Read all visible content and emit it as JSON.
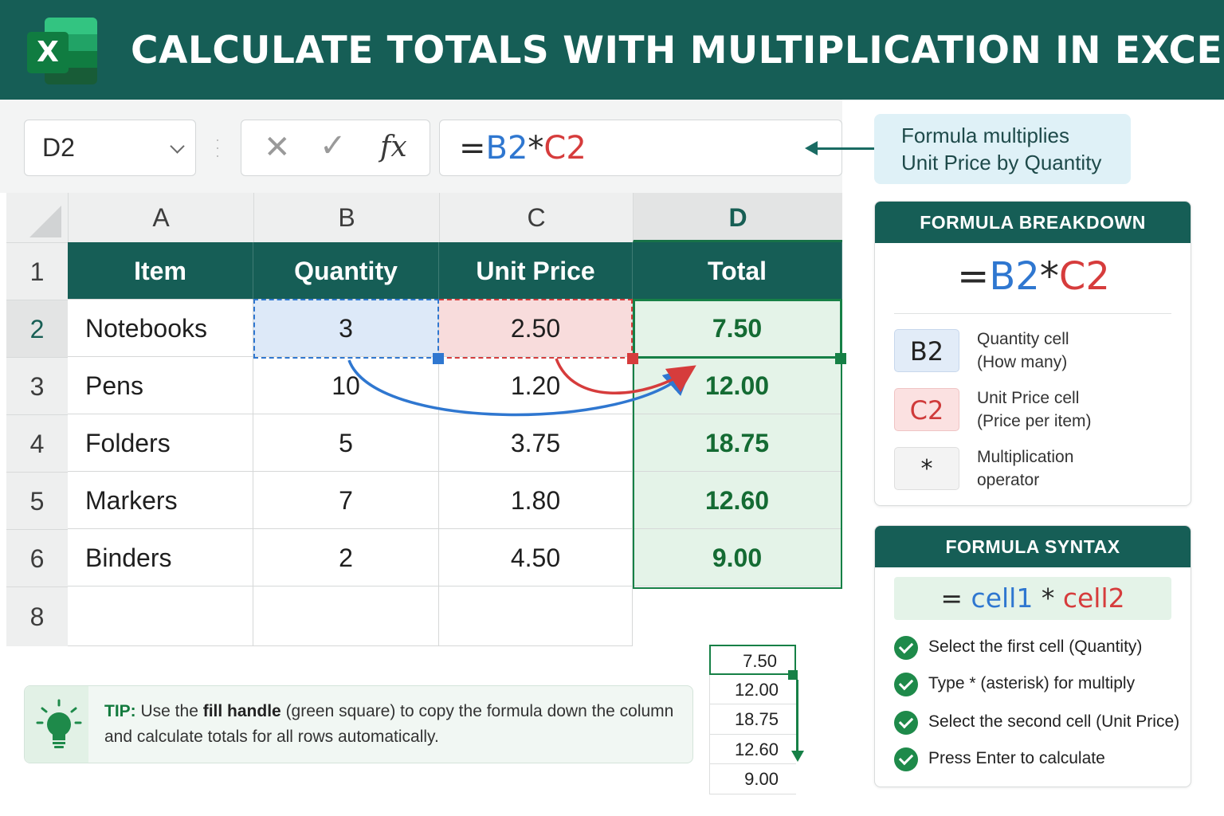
{
  "header": {
    "title": "CALCULATE TOTALS WITH MULTIPLICATION IN EXCEL",
    "logo_letter": "X"
  },
  "formula_bar": {
    "name_box": "D2",
    "cancel_glyph": "✕",
    "enter_glyph": "✓",
    "fx_label": "fx",
    "formula_parts": [
      "=",
      "B2",
      "*",
      "C2"
    ]
  },
  "callout": {
    "line1": "Formula multiplies",
    "line2": "Unit Price by Quantity"
  },
  "sheet": {
    "columns": [
      "A",
      "B",
      "C",
      "D"
    ],
    "row_numbers": [
      "1",
      "2",
      "3",
      "4",
      "5",
      "6",
      "8"
    ],
    "header_row": [
      "Item",
      "Quantity",
      "Unit Price",
      "Total"
    ],
    "rows": [
      [
        "Notebooks",
        "3",
        "2.50",
        "7.50"
      ],
      [
        "Pens",
        "10",
        "1.20",
        "12.00"
      ],
      [
        "Folders",
        "5",
        "3.75",
        "18.75"
      ],
      [
        "Markers",
        "7",
        "1.80",
        "12.60"
      ],
      [
        "Binders",
        "2",
        "4.50",
        "9.00"
      ]
    ]
  },
  "tip": {
    "label": "TIP:",
    "text1": " Use the ",
    "bold": "fill handle",
    "text2": " (green square) to copy the formula down the column",
    "line2": "and calculate totals for all rows automatically."
  },
  "fill_preview": [
    "7.50",
    "12.00",
    "18.75",
    "12.60",
    "9.00"
  ],
  "breakdown": {
    "title": "FORMULA BREAKDOWN",
    "formula_parts": [
      "=",
      "B2",
      "*",
      "C2"
    ],
    "items": [
      {
        "chip": "B2",
        "line1": "Quantity cell",
        "line2": "(How many)"
      },
      {
        "chip": "C2",
        "line1": "Unit Price cell",
        "line2": "(Price per item)"
      },
      {
        "chip": "*",
        "line1": "Multiplication",
        "line2": "operator"
      }
    ]
  },
  "syntax": {
    "title": "FORMULA SYNTAX",
    "parts": [
      "=",
      "cell1",
      "*",
      "cell2"
    ],
    "steps": [
      "Select the first cell (Quantity)",
      "Type * (asterisk) for multiply",
      "Select the second cell (Unit Price)",
      "Press Enter to calculate"
    ]
  },
  "colors": {
    "header_bg": "#165e56",
    "blue_ref": "#2f77d0",
    "red_ref": "#d63c3c",
    "total_green": "#146b33",
    "selection_green": "#168046"
  }
}
